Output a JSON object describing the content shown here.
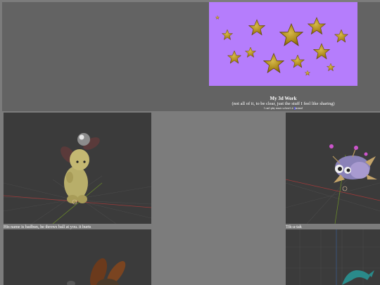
{
  "header": {
    "title": "My 3d Work",
    "subtitle": "(not all of it, to be clear, just the stuff I feel like sharing)",
    "note_before": "I can't play music so here's it",
    "note_highlight": "     ",
    "note_after": "instead"
  },
  "banner": {
    "background_color": "#b57dfc",
    "star_color": "#b08c1c",
    "star_count": 13
  },
  "gallery": [
    {
      "caption": "His name is badbun, he throws ball at you. it hurts"
    },
    {
      "caption": "Tik-a-tak"
    }
  ],
  "colors": {
    "page_bg": "#7c7c7c",
    "panel_bg": "#636363",
    "viewport_bg": "#3b3b3b"
  }
}
